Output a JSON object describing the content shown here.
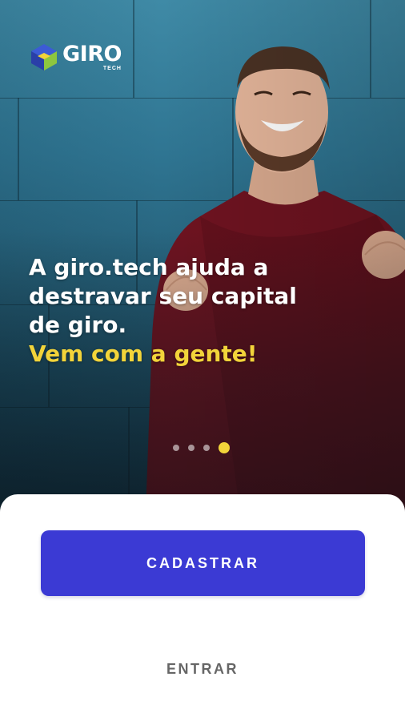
{
  "brand": {
    "logo_name": "GIRO",
    "logo_sub": "TECH",
    "logo_icon": "giro-cube-icon",
    "accent_color": "#f2d43a",
    "primary_color": "#3b3ad4"
  },
  "hero": {
    "image": "smiling-man-celebrating",
    "headline_lines": [
      "A giro.tech ajuda a",
      "destravar seu capital",
      "de giro."
    ],
    "headline_accent": "Vem com a gente!"
  },
  "carousel": {
    "total": 4,
    "active_index": 4
  },
  "actions": {
    "signup_label": "CADASTRAR",
    "login_label": "ENTRAR"
  }
}
